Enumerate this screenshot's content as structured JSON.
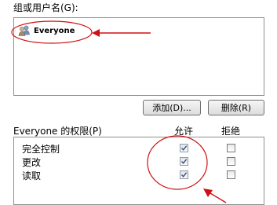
{
  "groups_label": "组或用户名(G):",
  "users": [
    {
      "name": "Everyone",
      "icon": "user-group-icon"
    }
  ],
  "buttons": {
    "add": "添加(D)...",
    "remove": "删除(R)"
  },
  "permissions": {
    "header": "Everyone 的权限(P)",
    "allow_label": "允许",
    "deny_label": "拒绝",
    "rows": [
      {
        "name": "完全控制",
        "allow": true,
        "deny": false
      },
      {
        "name": "更改",
        "allow": true,
        "deny": false
      },
      {
        "name": "读取",
        "allow": true,
        "deny": false
      }
    ]
  },
  "annotation_color": "#d01010"
}
